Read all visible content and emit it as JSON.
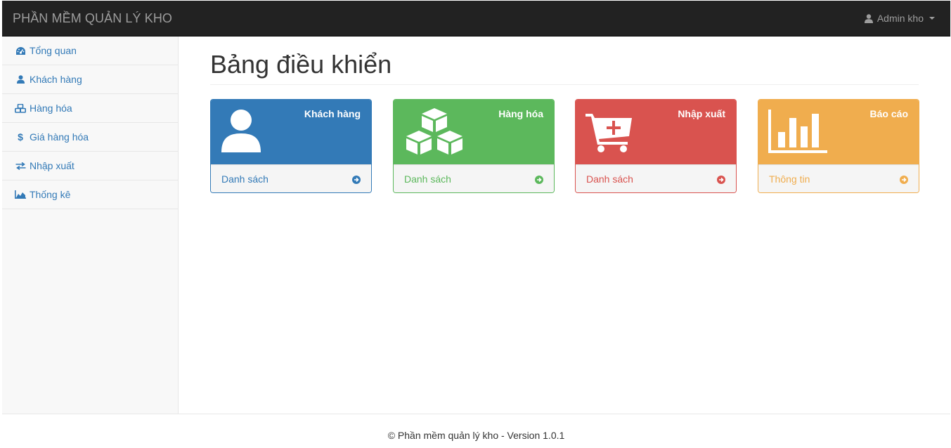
{
  "app": {
    "brand": "PHẦN MỀM QUẢN LÝ KHO"
  },
  "user_menu": {
    "label": "Admin kho",
    "icon": "user-icon"
  },
  "sidebar": {
    "items": [
      {
        "label": "Tổng quan",
        "icon": "dashboard-icon"
      },
      {
        "label": "Khách hàng",
        "icon": "user-icon"
      },
      {
        "label": "Hàng hóa",
        "icon": "cubes-icon"
      },
      {
        "label": "Giá hàng hóa",
        "icon": "dollar-icon"
      },
      {
        "label": "Nhập xuất",
        "icon": "exchange-icon"
      },
      {
        "label": "Thống kê",
        "icon": "area-chart-icon"
      }
    ]
  },
  "main": {
    "title": "Bảng điều khiển",
    "panels": [
      {
        "title": "Khách hàng",
        "link": "Danh sách",
        "icon": "user-icon",
        "color": "#337ab7"
      },
      {
        "title": "Hàng hóa",
        "link": "Danh sách",
        "icon": "cubes-icon",
        "color": "#5cb85c"
      },
      {
        "title": "Nhập xuất",
        "link": "Danh sách",
        "icon": "cart-plus-icon",
        "color": "#d9534f"
      },
      {
        "title": "Báo cáo",
        "link": "Thông tin",
        "icon": "bar-chart-icon",
        "color": "#f0ad4e"
      }
    ]
  },
  "footer": {
    "text": "© Phần mềm quản lý kho - Version 1.0.1"
  }
}
